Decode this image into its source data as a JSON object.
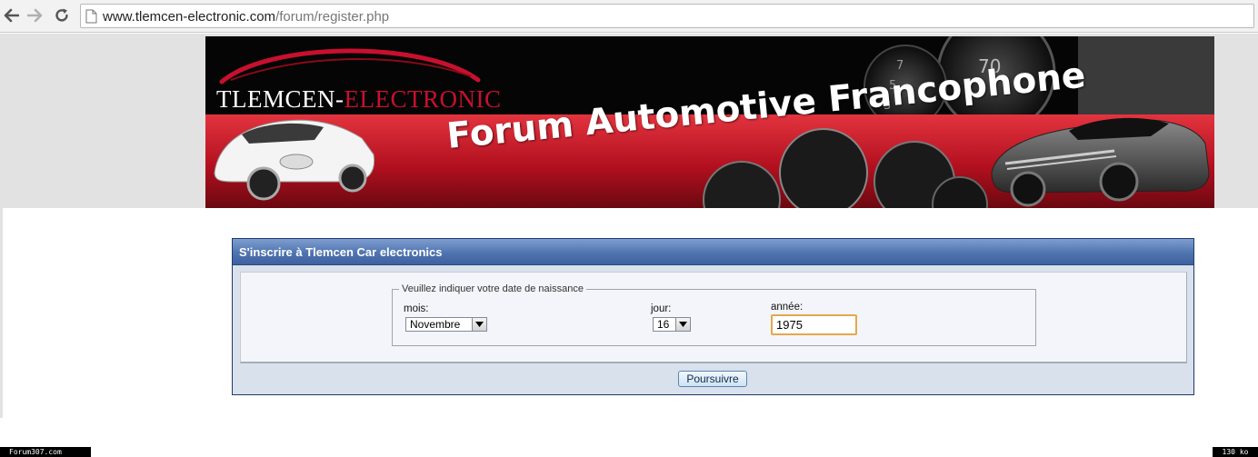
{
  "browser": {
    "url_host": "www.tlemcen-electronic.com",
    "url_path": "/forum/register.php"
  },
  "banner": {
    "brand_part1": "TLEMCEN-",
    "brand_part2": "ELECTRONIC",
    "tagline": "Forum Automotive Francophone"
  },
  "form": {
    "title": "S'inscrire à Tlemcen Car electronics",
    "legend": "Veuillez indiquer votre date de naissance",
    "month_label": "mois:",
    "month_value": "Novembre",
    "day_label": "jour:",
    "day_value": "16",
    "year_label": "année:",
    "year_value": "1975",
    "submit_label": "Poursuivre"
  },
  "statusbar": {
    "left_text": "Forum307.com",
    "right_text": "130 ko"
  },
  "colors": {
    "panel_header": "#4f74b0",
    "panel_border": "#1f3a6b",
    "brand_red": "#c8102e",
    "input_focus": "#e3a94b"
  }
}
